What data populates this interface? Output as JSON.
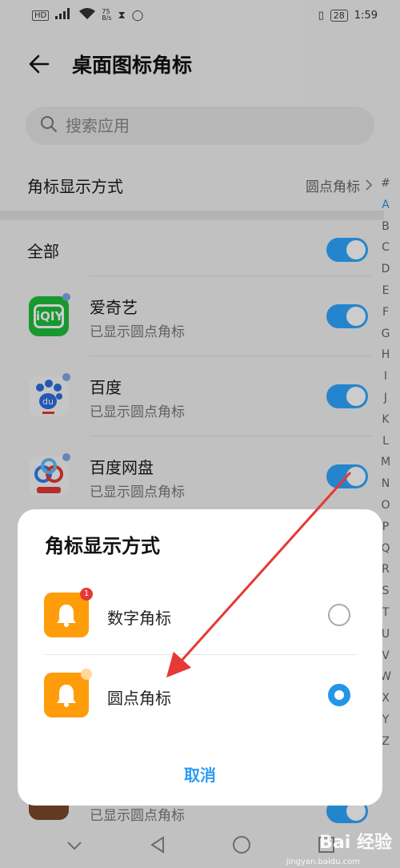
{
  "status": {
    "left_text": "HD",
    "speed": "75\nB/s",
    "time": "1:59",
    "battery": "28"
  },
  "header": {
    "title": "桌面图标角标"
  },
  "search": {
    "placeholder": "搜索应用"
  },
  "display_mode": {
    "label": "角标显示方式",
    "value": "圆点角标"
  },
  "all": {
    "label": "全部"
  },
  "apps": [
    {
      "name": "爱奇艺",
      "status": "已显示圆点角标",
      "icon": "iqiyi-icon",
      "color": "#1fbf3d"
    },
    {
      "name": "百度",
      "status": "已显示圆点角标",
      "icon": "baidu-paw-icon",
      "color": "#2d6ee0"
    },
    {
      "name": "百度网盘",
      "status": "已显示圆点角标",
      "icon": "baidu-netdisk-icon",
      "color": "#2a7ff0"
    },
    {
      "name": "",
      "status": "已显示圆点角标",
      "icon": "game-icon",
      "color": "#7a4a2a"
    }
  ],
  "alphabet": [
    "#",
    "A",
    "B",
    "C",
    "D",
    "E",
    "F",
    "G",
    "H",
    "I",
    "J",
    "K",
    "L",
    "M",
    "N",
    "O",
    "P",
    "Q",
    "R",
    "S",
    "T",
    "U",
    "V",
    "W",
    "X",
    "Y",
    "Z"
  ],
  "dialog": {
    "title": "角标显示方式",
    "options": [
      {
        "label": "数字角标",
        "badge": "1",
        "selected": false
      },
      {
        "label": "圆点角标",
        "selected": true
      }
    ],
    "cancel": "取消"
  },
  "watermark": {
    "main": "Bai 经验",
    "sub": "jingyan.baidu.com"
  },
  "colors": {
    "accent": "#2ea7ff",
    "option_icon": "#ff9c0a",
    "arrow": "#e53935"
  }
}
